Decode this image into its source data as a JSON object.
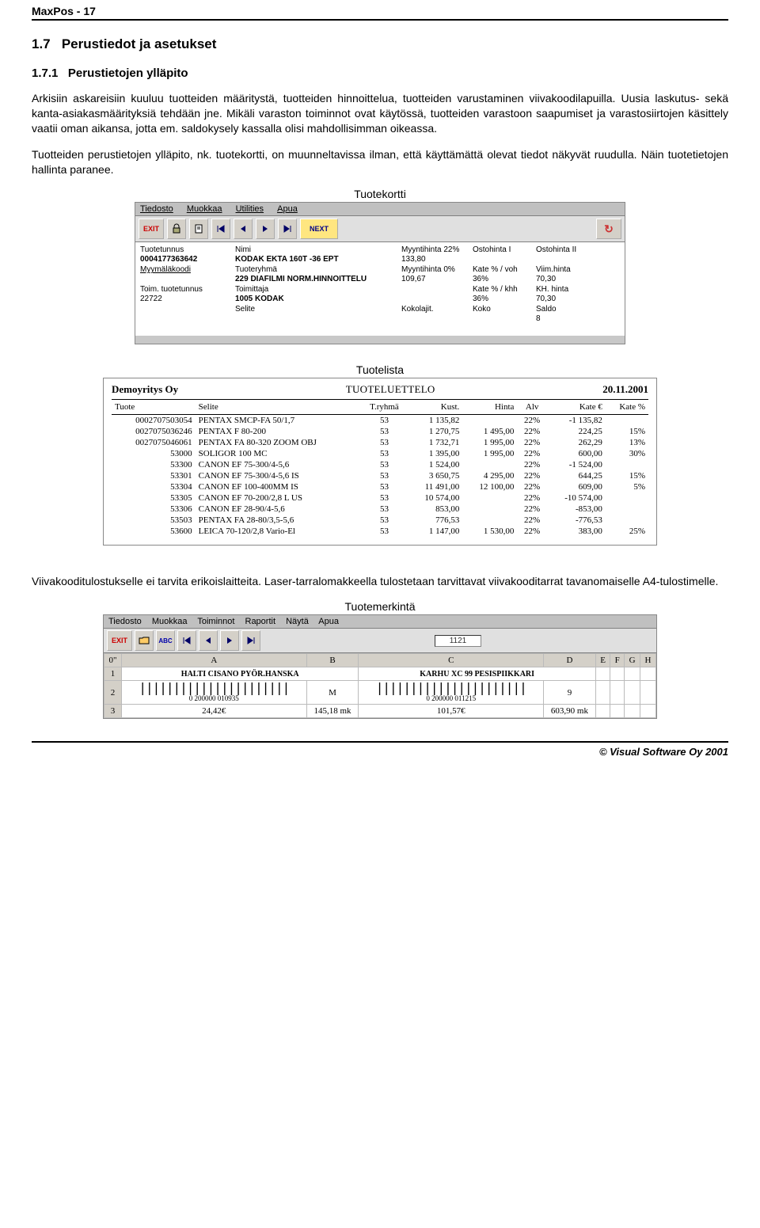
{
  "doc": {
    "header": "MaxPos  -  17",
    "section_num": "1.7",
    "section_title": "Perustiedot ja asetukset",
    "subsection_num": "1.7.1",
    "subsection_title": "Perustietojen ylläpito",
    "p1": "Arkisiin askareisiin kuuluu tuotteiden määritystä, tuotteiden hinnoittelua, tuotteiden varustaminen viivakoodilapuilla. Uusia laskutus- sekä kanta-asiakasmäärityksiä tehdään jne. Mikäli varaston toiminnot ovat käytössä, tuotteiden varastoon saapumiset ja varastosiirtojen käsittely vaatii oman aikansa, jotta em. saldokysely kassalla olisi mahdollisimman oikeassa.",
    "p2": "Tuotteiden perustietojen ylläpito, nk. tuotekortti, on muunneltavissa ilman, että käyttämättä olevat tiedot näkyvät ruudulla. Näin tuotetietojen hallinta paranee.",
    "cap1": "Tuotekortti",
    "cap2": "Tuotelista",
    "p3": "Viivakooditulostukselle ei tarvita erikoislaitteita. Laser-tarralomakkeella tulostetaan tarvittavat viivakooditarrat tavanomaiselle A4-tulostimelle.",
    "cap3": "Tuotemerkintä",
    "footer": "© Visual Software Oy 2001"
  },
  "tk": {
    "menu": [
      "Tiedosto",
      "Muokkaa",
      "Utilities",
      "Apua"
    ],
    "toolbar": {
      "exit": "EXIT",
      "next": "NEXT"
    },
    "labels": {
      "tuotetunnus": "Tuotetunnus",
      "nimi": "Nimi",
      "mh22": "Myyntihinta 22%",
      "oh1": "Ostohinta I",
      "oh2": "Ostohinta II",
      "mmkoodi": "Myymäläkoodi",
      "tryhma": "Tuoteryhmä",
      "mh0": "Myyntihinta 0%",
      "katevoh": "Kate % / voh",
      "viimhinta": "Viim.hinta",
      "toimtt": "Toim. tuotetunnus",
      "toimittaja": "Toimittaja",
      "katekhh": "Kate % / khh",
      "khhinta": "KH. hinta",
      "selite": "Selite",
      "kokolajit": "Kokolajit.",
      "koko": "Koko",
      "saldo": "Saldo"
    },
    "vals": {
      "tuotetunnus": "0004177363642",
      "nimi": "KODAK EKTA 160T -36  EPT",
      "mh22": "133,80",
      "mmkoodi": "",
      "tryhma": "229  DIAFILMI NORM.HINNOITTELU",
      "mh0": "109,67",
      "katevoh": "36%",
      "viimhinta": "70,30",
      "toimtt": "22722",
      "toimittaja": "1005  KODAK",
      "katekhh": "36%",
      "khhinta": "70,30",
      "saldo": "8"
    }
  },
  "tl": {
    "company": "Demoyritys Oy",
    "title": "TUOTELUETTELO",
    "date": "20.11.2001",
    "cols": [
      "Tuote",
      "Selite",
      "T.ryhmä",
      "Kust.",
      "Hinta",
      "Alv",
      "Kate €",
      "Kate %"
    ],
    "rows": [
      [
        "0002707503054",
        "PENTAX SMCP-FA 50/1,7",
        "53",
        "1 135,82",
        "",
        "22%",
        "-1 135,82",
        ""
      ],
      [
        "0027075036246",
        "PENTAX F 80-200",
        "53",
        "1 270,75",
        "1 495,00",
        "22%",
        "224,25",
        "15%"
      ],
      [
        "0027075046061",
        "PENTAX FA 80-320 ZOOM OBJ",
        "53",
        "1 732,71",
        "1 995,00",
        "22%",
        "262,29",
        "13%"
      ],
      [
        "53000",
        "SOLIGOR 100 MC",
        "53",
        "1 395,00",
        "1 995,00",
        "22%",
        "600,00",
        "30%"
      ],
      [
        "53300",
        "CANON EF 75-300/4-5,6",
        "53",
        "1 524,00",
        "",
        "22%",
        "-1 524,00",
        ""
      ],
      [
        "53301",
        "CANON EF 75-300/4-5,6 IS",
        "53",
        "3 650,75",
        "4 295,00",
        "22%",
        "644,25",
        "15%"
      ],
      [
        "53304",
        "CANON EF 100-400MM IS",
        "53",
        "11 491,00",
        "12 100,00",
        "22%",
        "609,00",
        "5%"
      ],
      [
        "53305",
        "CANON EF 70-200/2,8 L  US",
        "53",
        "10 574,00",
        "",
        "22%",
        "-10 574,00",
        ""
      ],
      [
        "53306",
        "CANON EF 28-90/4-5,6",
        "53",
        "853,00",
        "",
        "22%",
        "-853,00",
        ""
      ],
      [
        "53503",
        "PENTAX FA 28-80/3,5-5,6",
        "53",
        "776,53",
        "",
        "22%",
        "-776,53",
        ""
      ],
      [
        "53600",
        "LEICA 70-120/2,8 Vario-El",
        "53",
        "1 147,00",
        "1 530,00",
        "22%",
        "383,00",
        "25%"
      ]
    ]
  },
  "tm": {
    "menu": [
      "Tiedosto",
      "Muokkaa",
      "Toiminnot",
      "Raportit",
      "Näytä",
      "Apua"
    ],
    "count": "1121",
    "cols": [
      "0\"",
      "A",
      "B",
      "C",
      "D",
      "E",
      "F",
      "G",
      "H"
    ],
    "row1": [
      "1",
      "HALTI CISANO PYÖR.HANSKA",
      "",
      "KARHU XC 99 PESISPIIKKARI",
      "",
      "",
      "",
      "",
      ""
    ],
    "row2_label": "2",
    "row2_bc1": "0 200000 010935",
    "row2_m": "M",
    "row2_bc2": "0 200000 011215",
    "row2_9": "9",
    "row3": [
      "3",
      "24,42€",
      "145,18 mk",
      "101,57€",
      "603,90 mk",
      "",
      "",
      "",
      ""
    ]
  }
}
